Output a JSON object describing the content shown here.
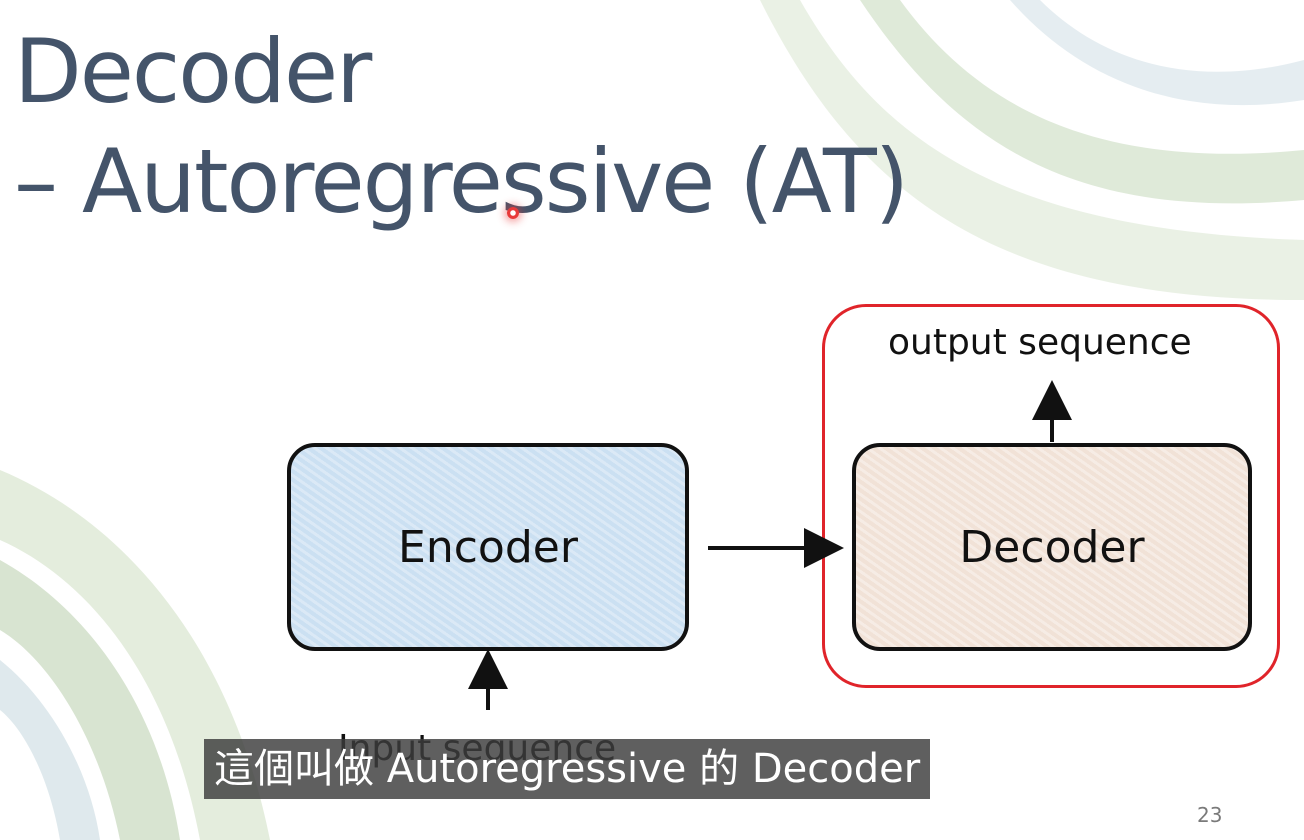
{
  "slide": {
    "title_line1": "Decoder",
    "title_line2": "– Autoregressive (AT)",
    "page_number": "23",
    "title_color": "#44546a",
    "highlight_color": "#e0242a"
  },
  "diagram": {
    "encoder_label": "Encoder",
    "decoder_label": "Decoder",
    "input_label": "Input sequence",
    "output_label": "output sequence",
    "encoder_fill": "#cfe2f3",
    "decoder_fill": "#f3e6dc"
  },
  "subtitle": {
    "text": "這個叫做 Autoregressive 的 Decoder"
  }
}
